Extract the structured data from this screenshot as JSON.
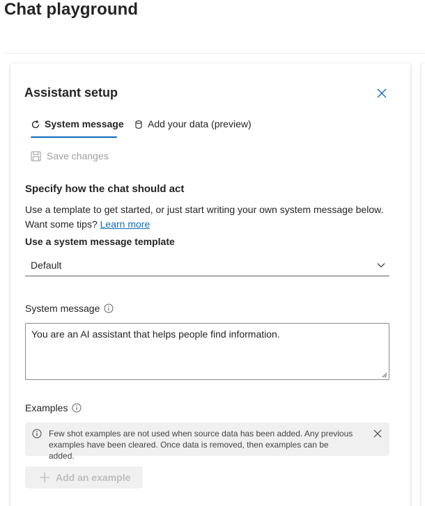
{
  "page": {
    "title": "Chat playground"
  },
  "panel": {
    "title": "Assistant setup",
    "tabs": [
      {
        "label": "System message",
        "icon": "refresh-icon",
        "active": true
      },
      {
        "label": "Add your data (preview)",
        "icon": "database-icon",
        "active": false
      }
    ],
    "save_label": "Save changes",
    "section_heading": "Specify how the chat should act",
    "help_text": "Use a template to get started, or just start writing your own system message below. Want some tips?",
    "learn_more": "Learn more",
    "template_label": "Use a system message template",
    "template_value": "Default",
    "system_message_label": "System message",
    "system_message_value": "You are an AI assistant that helps people find information.",
    "examples_label": "Examples",
    "examples_info": "Few shot examples are not used when source data has been added. Any previous examples have been cleared. Once data is removed, then examples can be added.",
    "add_example_label": "Add an example"
  },
  "colors": {
    "accent": "#0f6cbd",
    "disabled_text": "#a0a0a0",
    "info_bg": "#f0f0f0"
  }
}
